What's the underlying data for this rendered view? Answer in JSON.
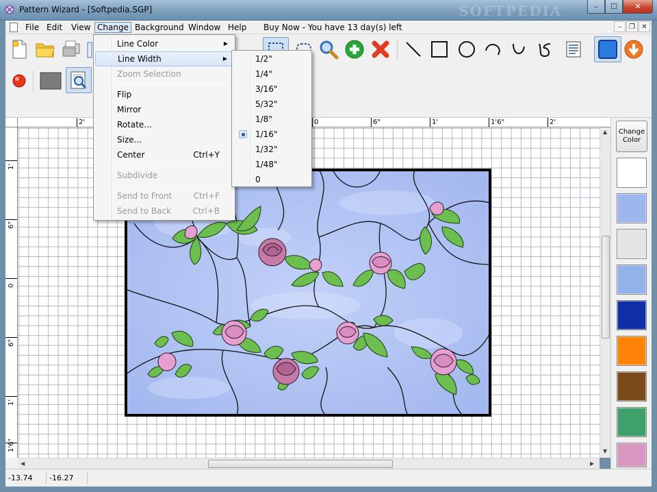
{
  "window": {
    "title": "Pattern Wizard - [Softpedia.SGP]",
    "watermark": "SOFTPEDIA",
    "minimize": "–",
    "maximize": "☐",
    "close": "✕"
  },
  "menubar": {
    "items": [
      "File",
      "Edit",
      "View",
      "Change",
      "Background",
      "Window",
      "Help"
    ],
    "active": "Change",
    "notice": "Buy Now - You have 13 day(s) left",
    "mdi_controls": [
      "–",
      "❐",
      "✕"
    ]
  },
  "change_menu": {
    "items": [
      {
        "label": "Line Color",
        "submenu": true
      },
      {
        "label": "Line Width",
        "submenu": true,
        "highlighted": true
      },
      {
        "label": "Zoom Selection",
        "disabled": true
      },
      {
        "label": "Flip"
      },
      {
        "label": "Mirror"
      },
      {
        "label": "Rotate..."
      },
      {
        "label": "Size..."
      },
      {
        "label": "Center",
        "shortcut": "Ctrl+Y"
      },
      {
        "label": "Subdivide",
        "disabled": true
      },
      {
        "label": "Send to Front",
        "shortcut": "Ctrl+F",
        "disabled": true
      },
      {
        "label": "Send to Back",
        "shortcut": "Ctrl+B",
        "disabled": true
      }
    ]
  },
  "line_width_menu": {
    "options": [
      "1/2\"",
      "1/4\"",
      "3/16\"",
      "5/32\"",
      "1/8\"",
      "1/16\"",
      "1/32\"",
      "1/48\"",
      "0"
    ],
    "selected": "1/16\""
  },
  "ruler_top": {
    "labels": [
      "2'",
      "0",
      "6\"",
      "1'",
      "1'6\"",
      "2'"
    ]
  },
  "ruler_left": {
    "labels": [
      "1'",
      "6\"",
      "0",
      "6\"",
      "1'",
      "1'6\""
    ]
  },
  "palette": {
    "button_label": "Change Color",
    "swatches": [
      "#ffffff",
      "#9db6ee",
      "#e4e4e4",
      "#93b2ea",
      "#0e2fa8",
      "#ff8305",
      "#7a4a18",
      "#3fa06c",
      "#d897c0"
    ]
  },
  "status": {
    "x": "-13.74",
    "y": "-16.27"
  },
  "colors": {
    "glass": "#b4c6f4",
    "leaf": "#6cbf4f",
    "rose": "#e5a0cf",
    "rose_dark": "#c57aa8",
    "accent": "#3f7fd1"
  }
}
